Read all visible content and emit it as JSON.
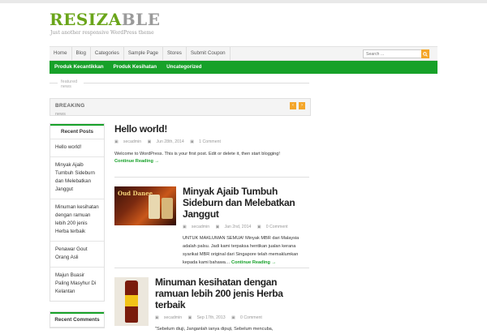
{
  "site": {
    "logo_part1": "RESIZA",
    "logo_part2": "BLE",
    "tagline": "Just another responsive WordPress theme"
  },
  "nav": {
    "items": [
      "Home",
      "Blog",
      "Categories",
      "Sample Page",
      "Stores",
      "Submit Coupon"
    ],
    "search_placeholder": "Search ..."
  },
  "categories": [
    "Produk Kecantikkan",
    "Produk Kesihatan",
    "Uncategorized"
  ],
  "featured": {
    "line1": "featured",
    "line2": "news"
  },
  "breaking": {
    "label": "BREAKING",
    "sub": "news"
  },
  "sidebar": {
    "recent_posts_title": "Recent Posts",
    "recent_posts": [
      "Hello world!",
      "Minyak Ajaib Tumbuh Sideburn dan Melebatkan Janggut",
      "Minuman kesihatan dengan ramuan lebih 200 jenis Herba terbaik",
      "Penawar Gout Orang Asli",
      "Majun Buasir Paling Masyhur Di Kelantan"
    ],
    "recent_comments_title": "Recent Comments"
  },
  "posts": [
    {
      "title": "Hello world!",
      "author": "secadmin",
      "date": "Jun 28th, 2014",
      "comments": "1 Comment",
      "excerpt": "Welcome to WordPress. This is your first post. Edit or delete it, then start blogging!",
      "more": "Continue Reading →"
    },
    {
      "title": "Minyak Ajaib Tumbuh Sideburn dan Melebatkan Janggut",
      "author": "secadmin",
      "date": "Jan 2nd, 2014",
      "comments": "0 Comment",
      "excerpt": "UNTUK MAKLUMAN SEMUA! Minyak MBR dari Malaysia adalah palsu. Jadi kami terpaksa hentikan jualan kerana syarikat MBR original dari Singapore telah memaklumkan kepada kami bahawa…",
      "more": "Continue Reading →",
      "thumb_text": "Oud Danee"
    },
    {
      "title": "Minuman kesihatan dengan ramuan lebih 200 jenis Herba terbaik",
      "author": "secadmin",
      "date": "Sep 17th, 2013",
      "comments": "0 Comment",
      "excerpt": "\"Sebelum diuji, Janganlah ianya dipuji, Sebelum mencuba,"
    }
  ],
  "colors": {
    "brand_green": "#17a129",
    "logo_green": "#6aa51a",
    "accent_orange": "#f4a62a"
  }
}
